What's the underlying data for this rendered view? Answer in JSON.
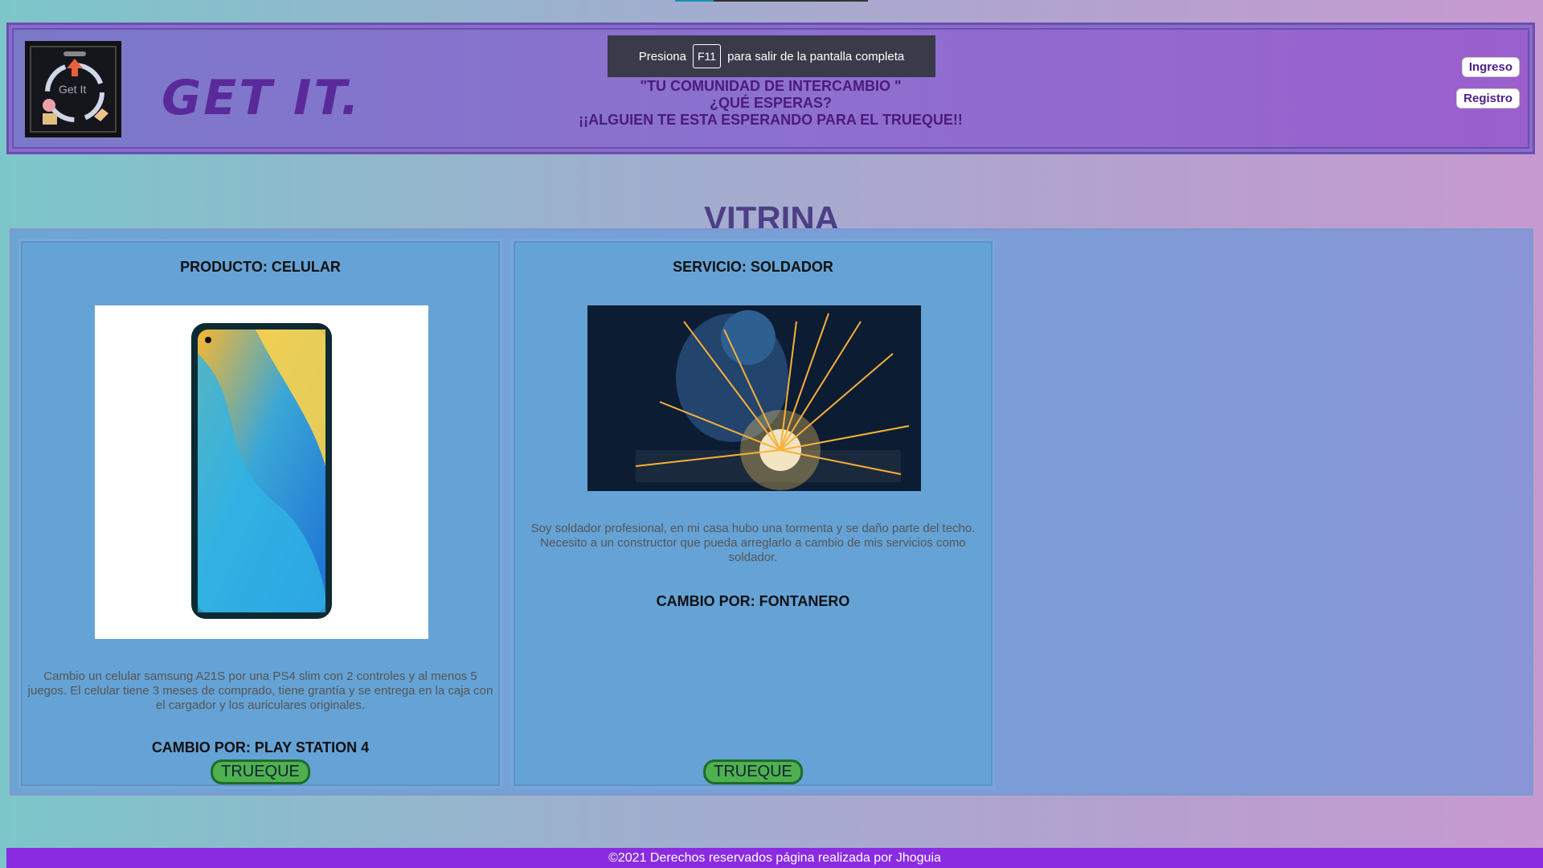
{
  "header": {
    "logo_text": "Get It",
    "brand": "GET IT.",
    "slogan_line1": "\"TU COMUNIDAD DE INTERCAMBIO \"",
    "slogan_line2": "¿QUÉ ESPERAS?",
    "slogan_line3": "¡¡ALGUIEN TE ESTA ESPERANDO PARA EL TRUEQUE!!",
    "login_label": "Ingreso",
    "register_label": "Registro"
  },
  "fullscreen_notice": {
    "before": "Presiona",
    "key": "F11",
    "after": "para salir de la pantalla completa"
  },
  "page_title": "VITRINA",
  "cards": [
    {
      "title": "PRODUCTO: CELULAR",
      "image": "smartphone-image",
      "description": "Cambio un celular samsung A21S por una PS4 slim con 2 controles y al menos 5 juegos. El celular tiene 3 meses de comprado, tiene grantía y se entrega en la caja con el cargador y los auriculares originales.",
      "exchange": "CAMBIO POR: PLAY STATION 4",
      "button": "TRUEQUE"
    },
    {
      "title": "SERVICIO: SOLDADOR",
      "image": "welder-image",
      "description": "Soy soldador profesional, en mi casa hubo una tormenta y se daño parte del techo. Necesito a un constructor que pueda arreglarlo a cambio de mis servicios como soldador.",
      "exchange": "CAMBIO POR: FONTANERO",
      "button": "TRUEQUE"
    }
  ],
  "footer": "©2021 Derechos reservados página realizada por Jhoguia"
}
